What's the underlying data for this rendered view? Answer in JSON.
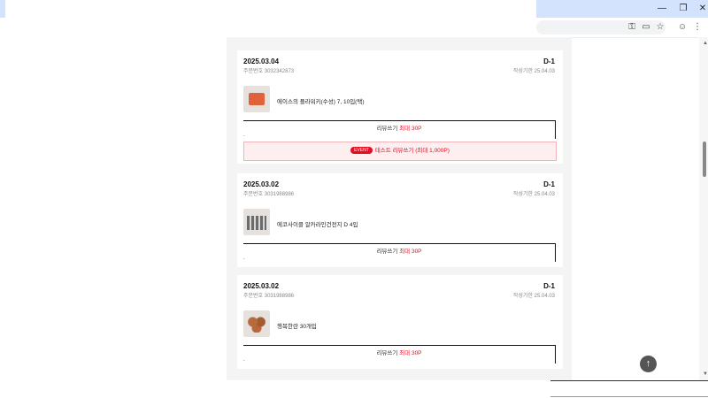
{
  "browser": {
    "minimize_icon": "minimize-icon",
    "restore_icon": "restore-icon",
    "close_icon": "close-icon",
    "toolbar_icons": [
      "key-icon",
      "cast-icon",
      "bookmark-star-icon",
      "profile-icon",
      "menu-dots-icon"
    ]
  },
  "orders": [
    {
      "date": "2025.03.04",
      "dday": "D-1",
      "order_no": "주문번호 3032342873",
      "deadline": "작성기한 25.04.03",
      "product": "에이스의 플라워키(수성) 7, 10입(택)",
      "write_label": "리뷰쓰기",
      "write_points": "최대 30P",
      "promo_tag": "EVENT",
      "promo_text": "테스트 리뷰쓰기 ",
      "promo_points": "(최대 1,000P)"
    },
    {
      "date": "2025.03.02",
      "dday": "D-1",
      "order_no": "주문번호 3031988986",
      "deadline": "작성기한 25.04.03",
      "product": "에코사이클 알카라인건전지 D 4입",
      "write_label": "리뷰쓰기",
      "write_points": "최대 30P"
    },
    {
      "date": "2025.03.02",
      "dday": "D-1",
      "order_no": "주문번호 3031988986",
      "deadline": "작성기한 25.04.03",
      "product": "행복한란 30개입",
      "write_label": "리뷰쓰기",
      "write_points": "최대 30P"
    }
  ],
  "scroll_top_icon": "arrow-up-icon",
  "colors": {
    "accent": "#e30e22",
    "chrome": "#d3e3fd"
  }
}
